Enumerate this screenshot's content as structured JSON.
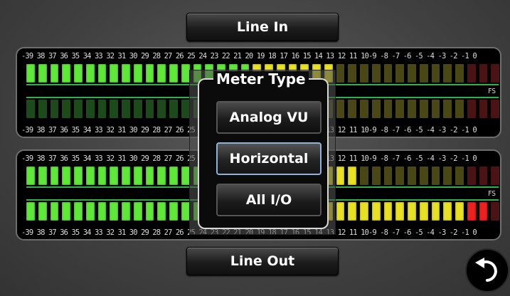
{
  "top_tab": {
    "label": "Line In"
  },
  "bottom_tab": {
    "label": "Line Out"
  },
  "scale_text": "-39 38 37 36 35 34 33 32 31 30 29 28 27 26 25 24 23 22 21 20 19 18 17 16 15 14 13 12 11 10-9 -8 -7 -6 -5 -4 -3 -2 -1 0",
  "fs_label": "FS",
  "meters": {
    "in_1_level_db": -14,
    "in_2_level_db": -40,
    "out_1_level_db": -12,
    "out_2_level_db": -1
  },
  "dialog": {
    "title": "Meter Type",
    "options": [
      "Analog VU",
      "Horizontal",
      "All I/O"
    ],
    "selected": "Horizontal"
  },
  "colors": {
    "green_on": "#5fe83a",
    "green_off": "#1c4a1a",
    "yellow_on": "#e8e022",
    "yellow_off": "#4a4716",
    "red_on": "#ee2020",
    "red_off": "#4a1414"
  },
  "icons": {
    "back": "return-arrow-icon"
  }
}
